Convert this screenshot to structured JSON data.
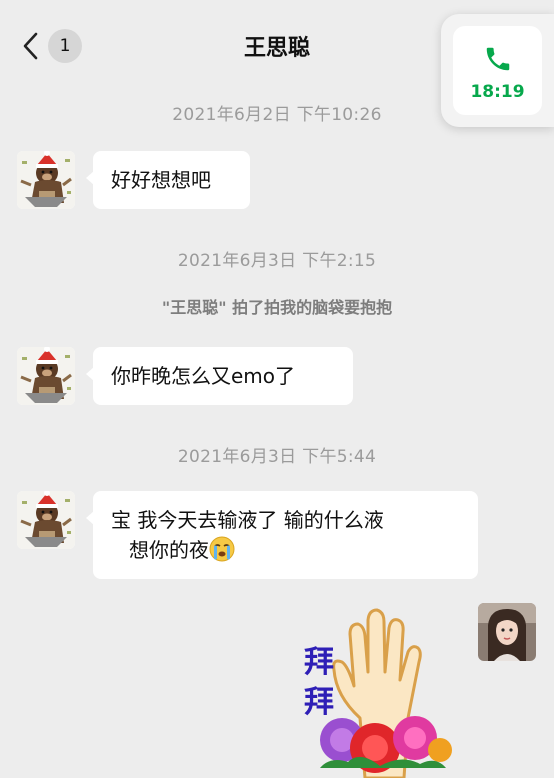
{
  "header": {
    "back_badge": "1",
    "title": "王思聪"
  },
  "call": {
    "time": "18:19",
    "accent": "#07a84c"
  },
  "messages": {
    "ts1": "2021年6月2日 下午10:26",
    "msg1": "好好想想吧",
    "ts2": "2021年6月3日 下午2:15",
    "system_pat": "\"王思聪\" 拍了拍我的脑袋要抱抱",
    "msg2": "你昨晚怎么又emo了",
    "ts3": "2021年6月3日 下午5:44",
    "msg3_line1": "宝  我今天去输液了   输的什么液",
    "msg3_line2": "想你的夜"
  },
  "sticker": {
    "text_top": "拜",
    "text_bottom": "拜"
  },
  "icons": {
    "back": "chevron-left-icon",
    "call": "phone-icon",
    "emoji": "crying-face-icon"
  }
}
